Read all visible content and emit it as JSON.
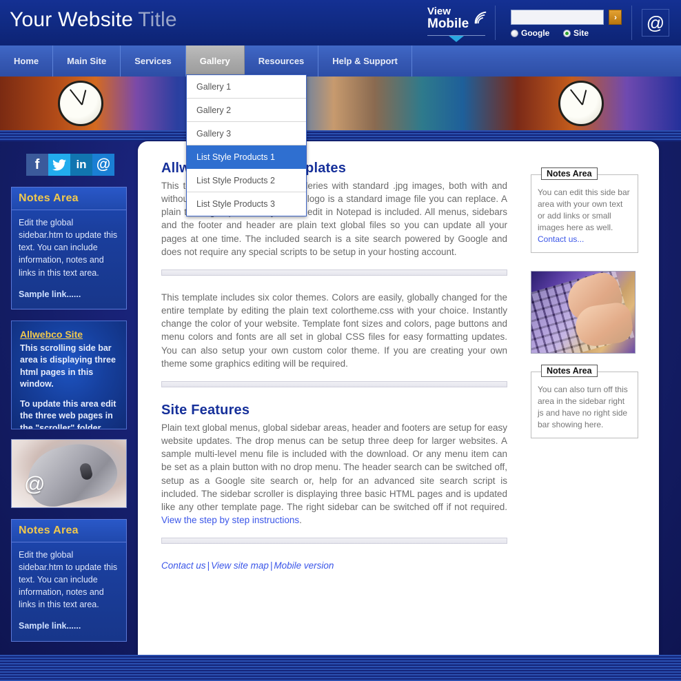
{
  "header": {
    "logo_bold": "Your Website",
    "logo_light": "Title",
    "view_mobile_line1": "View",
    "view_mobile_line2": "Mobile",
    "wifi_icon": "wifi-icon",
    "triangle_icon": "triangle-down-icon",
    "search": {
      "value": "",
      "placeholder": "",
      "go_label": "›",
      "radio_google": "Google",
      "radio_site": "Site",
      "selected": "Site"
    },
    "at_icon_label": "@"
  },
  "nav": {
    "items": [
      {
        "label": "Home",
        "active": false
      },
      {
        "label": "Main Site",
        "active": false
      },
      {
        "label": "Services",
        "active": false
      },
      {
        "label": "Gallery",
        "active": true
      },
      {
        "label": "Resources",
        "active": false
      },
      {
        "label": "Help & Support",
        "active": false
      }
    ]
  },
  "dropdown": {
    "open_for": "Gallery",
    "items": [
      {
        "label": "Gallery 1",
        "highlighted": false
      },
      {
        "label": "Gallery 2",
        "highlighted": false
      },
      {
        "label": "Gallery 3",
        "highlighted": false
      },
      {
        "label": "List Style Products 1",
        "highlighted": true
      },
      {
        "label": "List Style Products 2",
        "highlighted": false
      },
      {
        "label": "List Style Products 3",
        "highlighted": false
      }
    ]
  },
  "left_sidebar": {
    "social": [
      {
        "name": "facebook-icon",
        "glyph": "f"
      },
      {
        "name": "twitter-icon",
        "glyph": "ᴛ"
      },
      {
        "name": "linkedin-icon",
        "glyph": "in"
      },
      {
        "name": "email-icon",
        "glyph": "@"
      }
    ],
    "notes_top": {
      "title": "Notes Area",
      "body": "Edit the global sidebar.htm to update this text. You can include information, notes and links in this text area.",
      "link": "Sample link......"
    },
    "scroller": {
      "link": "Allwebco Site",
      "para1": "This scrolling side bar area is displaying three html pages in this window.",
      "para2": "To update this area edit the three web pages in the \"scroller\" folder with any HTML or plain text editor. Edit these pages like any other page."
    },
    "image": {
      "name": "computer-mouse-image",
      "overlay": "@"
    },
    "notes_bottom": {
      "title": "Notes Area",
      "body": "Edit the global sidebar.htm to update this text. You can include information, notes and links in this text area.",
      "link": "Sample link......"
    }
  },
  "main": {
    "heading1": "Allwebco Design Templates",
    "para1": "This template includes picture galleries with standard .jpg images, both with and without photo albums. The header logo is a standard image file you can replace. A plain text logo option that you can edit in Notepad is included. All menus, sidebars and the footer and header are plain text global files so you can update all your pages at one time. The included search is a site search powered by Google and does not require any special scripts to be setup in your hosting account.",
    "para2": "This template includes six color themes. Colors are easily, globally changed for the entire template by editing the plain text colortheme.css with your choice. Instantly change the color of your website. Template font sizes and colors, page buttons and menu colors and fonts are all set in global CSS files for easy formatting updates. You can also setup your own custom color theme. If you are creating your own theme some graphics editing will be required.",
    "heading2": "Site Features",
    "para3_before_link": "Plain text global menus, global sidebar areas, header and footers are setup for easy website updates. The drop menus can be setup three deep for larger websites. A sample multi-level menu file is included with the download. Or any menu item can be set as a plain button with no drop menu. The header search can be switched off, setup as a Google site search or, help for an advanced site search script is included. The sidebar scroller is displaying three basic HTML pages and is updated like any other template page. The right sidebar can be switched off if not required. ",
    "para3_link": "View the step by step instructions",
    "para3_after_link": ".",
    "footer_links": [
      {
        "label": "Contact us"
      },
      {
        "label": "View site map"
      },
      {
        "label": "Mobile version"
      }
    ],
    "footer_separator": "|"
  },
  "right_sidebar": {
    "notes_top": {
      "title": "Notes Area",
      "body": "You can edit this side bar area with your own text or add links or small images here as well.",
      "link": "Contact us..."
    },
    "image": {
      "name": "keyboard-typing-image"
    },
    "notes_bottom": {
      "title": "Notes Area",
      "body": "You can also turn off this area in the sidebar right js and have no right side bar showing here."
    }
  },
  "colors": {
    "header_blue": "#102a82",
    "nav_blue": "#3659b4",
    "nav_active_gray": "#a8a8a8",
    "dropdown_highlight": "#2f6fd0",
    "heading_blue": "#16309a",
    "link_blue": "#3b56e8",
    "notes_title_gold": "#f2c94c",
    "go_button_orange": "#c98a16",
    "radio_selected_green": "#2ea22e"
  }
}
